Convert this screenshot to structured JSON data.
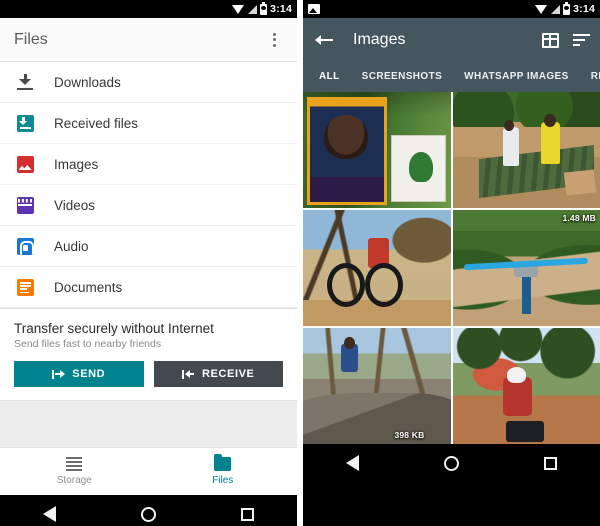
{
  "left": {
    "status": {
      "time": "3:14",
      "icons": [
        "wifi-icon",
        "signal-icon",
        "battery-icon"
      ]
    },
    "appbar": {
      "title": "Files",
      "overflow": "overflow-menu-icon"
    },
    "files": [
      {
        "label": "Downloads",
        "icon": "download-icon",
        "color": "#4a4a4a"
      },
      {
        "label": "Received files",
        "icon": "received-files-icon",
        "color": "#108a96"
      },
      {
        "label": "Images",
        "icon": "images-icon",
        "color": "#d32f2f"
      },
      {
        "label": "Videos",
        "icon": "videos-icon",
        "color": "#5e35b1"
      },
      {
        "label": "Audio",
        "icon": "audio-icon",
        "color": "#1976d2"
      },
      {
        "label": "Documents",
        "icon": "documents-icon",
        "color": "#f57c00"
      }
    ],
    "transfer": {
      "title": "Transfer securely without Internet",
      "subtitle": "Send files fast to nearby friends",
      "send_label": "SEND",
      "receive_label": "RECEIVE",
      "send_color": "#00838f",
      "receive_color": "#424a4f"
    },
    "bottom_nav": [
      {
        "label": "Storage",
        "icon": "storage-icon",
        "active": false
      },
      {
        "label": "Files",
        "icon": "folder-icon",
        "active": true
      }
    ],
    "accent_color": "#00838f"
  },
  "right": {
    "status": {
      "time": "3:14",
      "icons": [
        "photo-icon",
        "wifi-icon",
        "signal-icon",
        "battery-icon"
      ]
    },
    "appbar": {
      "title": "Images",
      "back": "back-arrow-icon",
      "view_toggle": "grid-view-icon",
      "sort": "sort-icon",
      "color": "#46565e"
    },
    "tabs": [
      {
        "label": "ALL",
        "active": true
      },
      {
        "label": "SCREENSHOTS",
        "active": false
      },
      {
        "label": "WHATSAPP IMAGES",
        "active": false
      },
      {
        "label": "REGRAM",
        "active": false
      }
    ],
    "gallery": [
      {
        "name": "poster-wall-photo",
        "badge": ""
      },
      {
        "name": "friends-on-bench-photo",
        "badge": ""
      },
      {
        "name": "cyclist-under-tree-photo",
        "badge": ""
      },
      {
        "name": "handlebar-trail-photo",
        "badge": "1.48 MB"
      },
      {
        "name": "rocky-trail-rider-photo",
        "badge": "398 KB"
      },
      {
        "name": "downhill-rider-photo",
        "badge": ""
      }
    ]
  },
  "navbar": {
    "back": "back-triangle-icon",
    "home": "home-circle-icon",
    "recents": "recents-square-icon"
  }
}
